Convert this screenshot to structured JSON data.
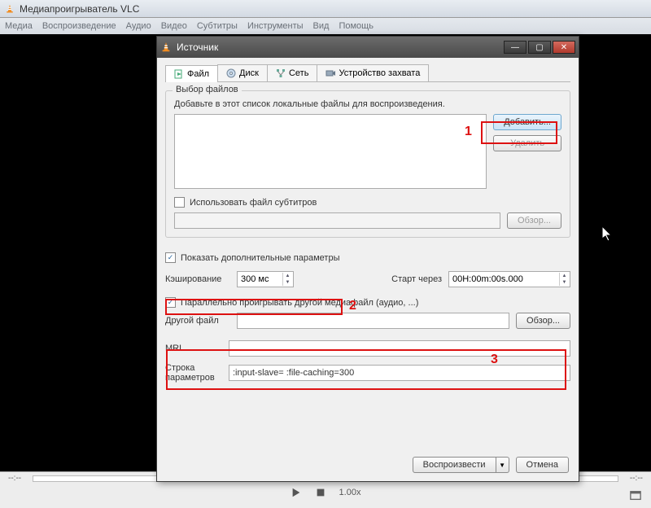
{
  "main": {
    "title": "Медиапроигрыватель VLC",
    "menu": [
      "Медиа",
      "Воспроизведение",
      "Аудио",
      "Видео",
      "Субтитры",
      "Инструменты",
      "Вид",
      "Помощь"
    ],
    "time_left": "--:--",
    "time_right": "--:--",
    "speed": "1.00x"
  },
  "dialog": {
    "title": "Источник",
    "tabs": {
      "file": "Файл",
      "disc": "Диск",
      "net": "Сеть",
      "capture": "Устройство захвата"
    },
    "group_legend": "Выбор файлов",
    "hint": "Добавьте в этот список локальные файлы для воспроизведения.",
    "add_btn": "Добавить...",
    "del_btn": "Удалить",
    "use_sub": "Использовать файл субтитров",
    "browse": "Обзор...",
    "show_extra": "Показать дополнительные параметры",
    "caching_lbl": "Кэширование",
    "caching_val": "300 мс",
    "start_lbl": "Старт через",
    "start_val": "00H:00m:00s.000",
    "parallel": "Параллельно проигрывать другой медиафайл (аудио, ...)",
    "other_file_lbl": "Другой файл",
    "mrl_lbl": "MRL",
    "mrl_val": "",
    "params_lbl": "Строка параметров",
    "params_val": ":input-slave=  :file-caching=300",
    "play_btn": "Воспроизвести",
    "cancel_btn": "Отмена"
  },
  "annotations": {
    "n1": "1",
    "n2": "2",
    "n3": "3"
  }
}
